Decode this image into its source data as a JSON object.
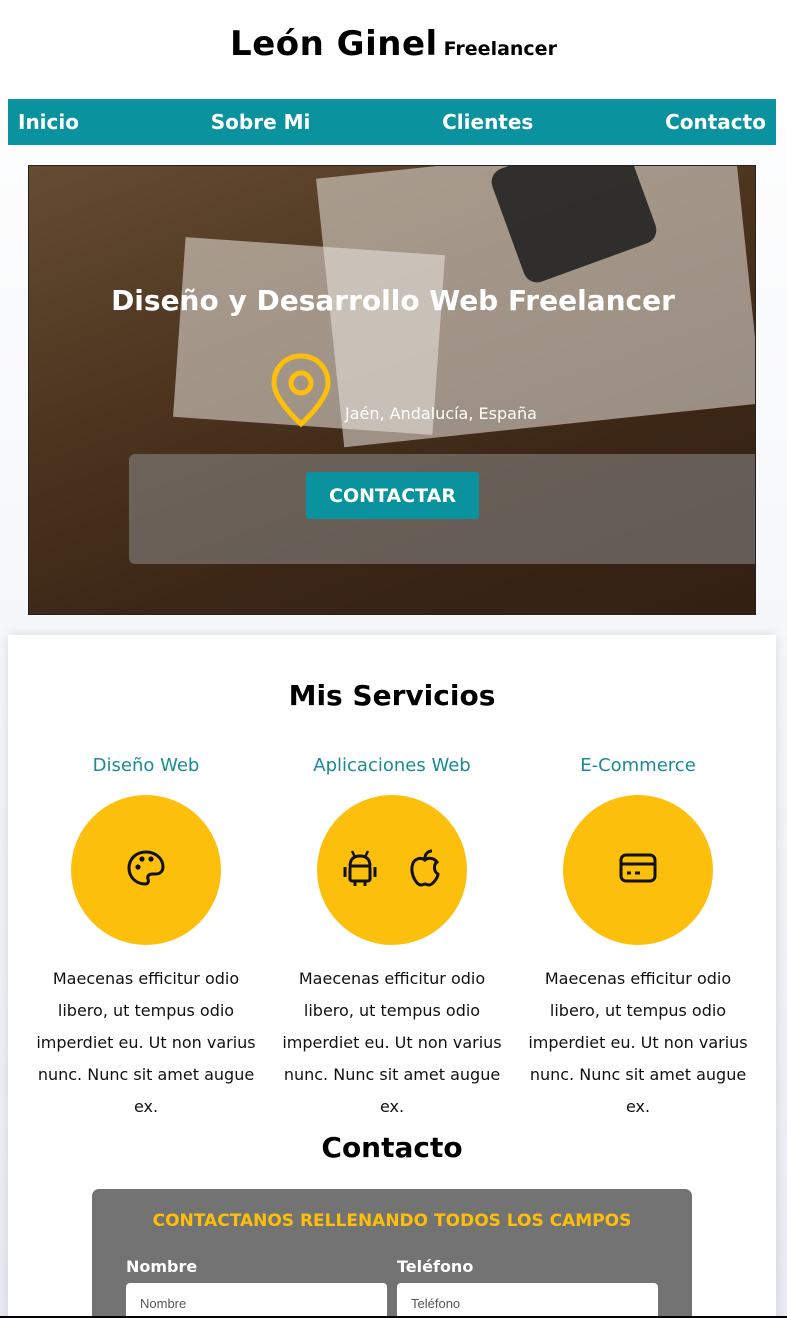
{
  "header": {
    "title": "León Ginel",
    "subtitle": "Freelancer"
  },
  "nav": {
    "items": [
      {
        "label": "Inicio"
      },
      {
        "label": "Sobre Mi"
      },
      {
        "label": "Clientes"
      },
      {
        "label": "Contacto"
      }
    ]
  },
  "hero": {
    "title": "Diseño y Desarrollo Web Freelancer",
    "location": "Jaén, Andalucía, España",
    "button_label": "CONTACTAR",
    "icon": "map-pin-icon"
  },
  "services": {
    "title": "Mis Servicios",
    "items": [
      {
        "name": "Diseño Web",
        "icon": "palette-icon",
        "description": "Maecenas efficitur odio libero, ut tempus odio imperdiet eu. Ut non varius nunc. Nunc sit amet augue ex."
      },
      {
        "name": "Aplicaciones Web",
        "icon": "android-apple-icon",
        "description": "Maecenas efficitur odio libero, ut tempus odio imperdiet eu. Ut non varius nunc. Nunc sit amet augue ex."
      },
      {
        "name": "E-Commerce",
        "icon": "credit-card-icon",
        "description": "Maecenas efficitur odio libero, ut tempus odio imperdiet eu. Ut non varius nunc. Nunc sit amet augue ex."
      }
    ]
  },
  "contact": {
    "title": "Contacto",
    "form_heading": "CONTACTANOS RELLENANDO TODOS LOS CAMPOS",
    "fields": {
      "name_label": "Nombre",
      "name_placeholder": "Nombre",
      "phone_label": "Teléfono",
      "phone_placeholder": "Teléfono"
    }
  },
  "colors": {
    "accent_teal": "#0a929f",
    "accent_yellow": "#fcbf0b",
    "form_bg": "#737373"
  }
}
